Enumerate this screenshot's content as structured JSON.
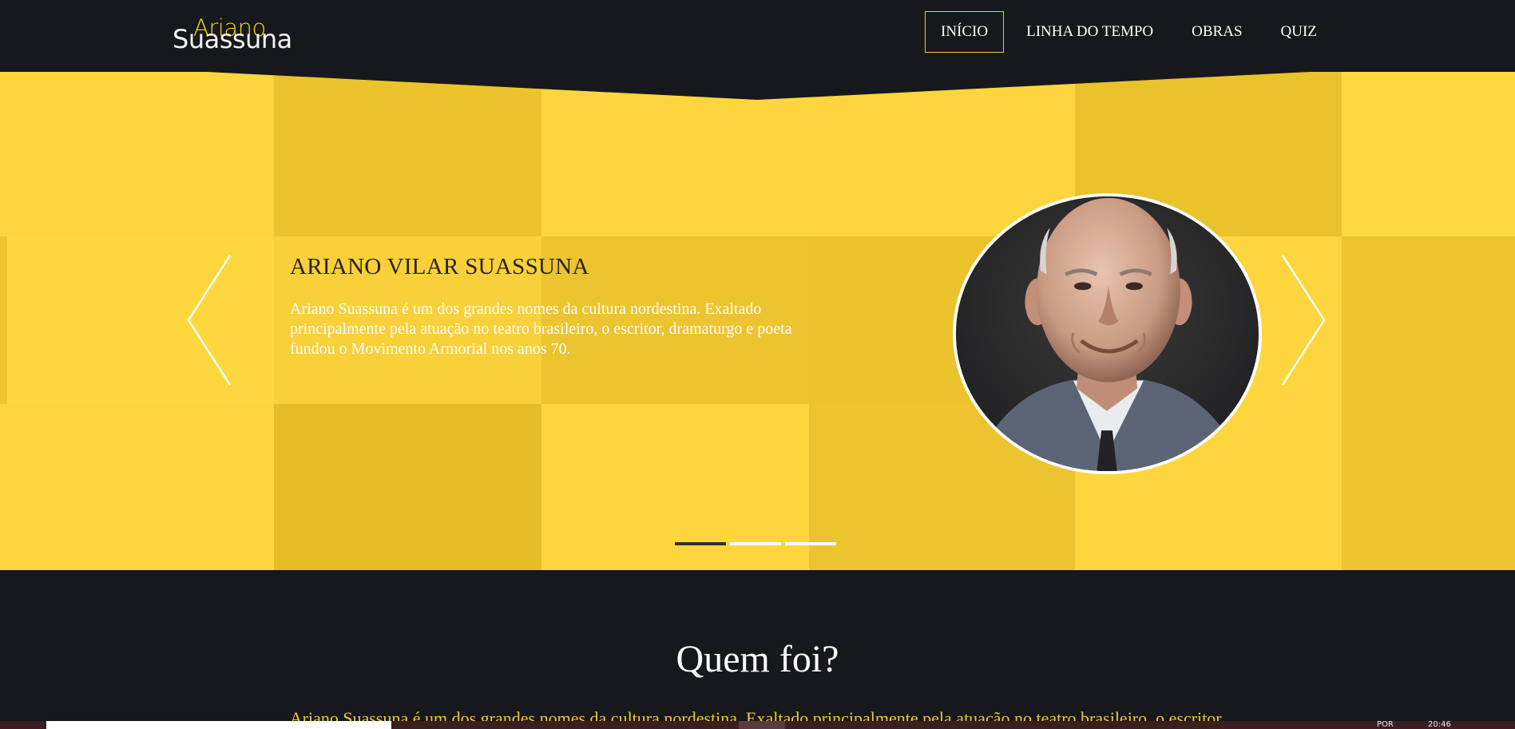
{
  "header": {
    "logo": {
      "top": "Ariano",
      "bottom": "Suassuna"
    },
    "nav": [
      {
        "label": "INÍCIO",
        "active": true
      },
      {
        "label": "LINHA DO TEMPO",
        "active": false
      },
      {
        "label": "OBRAS",
        "active": false
      },
      {
        "label": "QUIZ",
        "active": false
      }
    ]
  },
  "hero": {
    "title": "ARIANO VILAR SUASSUNA",
    "description": "Ariano Suassuna é um dos grandes nomes da cultura nordestina. Exaltado principalmente pela atuação no teatro brasileiro, o escritor, dramaturgo e poeta fundou o Movimento Armorial nos anos 70.",
    "slides": {
      "count": 3,
      "active": 0
    },
    "portrait_icon": "portrait-photo",
    "prev_icon": "chevron-left-icon",
    "next_icon": "chevron-right-icon"
  },
  "about": {
    "title": "Quem foi?",
    "text": "Ariano Suassuna é um dos grandes nomes da cultura nordestina. Exaltado principalmente pela atuação no teatro brasileiro, o escritor,"
  },
  "taskbar": {
    "lang": "POR",
    "clock": "20:46"
  },
  "colors": {
    "dark": "#17181c",
    "accent_yellow": "#f4c92a",
    "hero_yellow": "#f4cc31",
    "text_white": "#ffffff"
  }
}
